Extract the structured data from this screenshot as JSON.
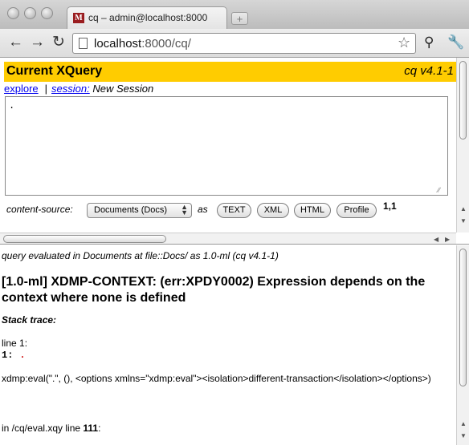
{
  "browser": {
    "tab_title": "cq – admin@localhost:8000",
    "favicon_letter": "M",
    "url_host": "localhost",
    "url_rest": ":8000/cq/",
    "icons": {
      "back": "back-arrow-icon",
      "forward": "forward-arrow-icon",
      "reload": "reload-icon",
      "page": "page-icon",
      "star": "star-icon",
      "tools": "wrench-icon"
    }
  },
  "query_frame": {
    "title": "Current XQuery",
    "version": "cq v4.1-1",
    "explore_link": "explore",
    "separator": "|",
    "session_link": "session:",
    "session_name": "New Session",
    "query_text": ".",
    "content_source_label": "content-source:",
    "content_source_selected": "Documents (Docs)",
    "as_label": "as",
    "buttons": [
      "TEXT",
      "XML",
      "HTML",
      "Profile"
    ],
    "cursor_position": "1,1",
    "accent_color": "#ffcc00"
  },
  "result_frame": {
    "eval_line": "query evaluated in Documents at file::Docs/ as 1.0-ml (cq v4.1-1)",
    "error_title": "[1.0-ml] XDMP-CONTEXT: (err:XPDY0002) Expression depends on the context where none is defined",
    "stack_label": "Stack trace:",
    "line_label": "line 1:",
    "code_line_number": "1:",
    "code_line_text": ".",
    "eval_expression": "xdmp:eval(\".\", (), <options xmlns=\"xdmp:eval\"><isolation>different-transaction</isolation></options>)",
    "location_prefix": "in /cq/eval.xqy line ",
    "location_line": "111",
    "location_suffix": ":"
  }
}
